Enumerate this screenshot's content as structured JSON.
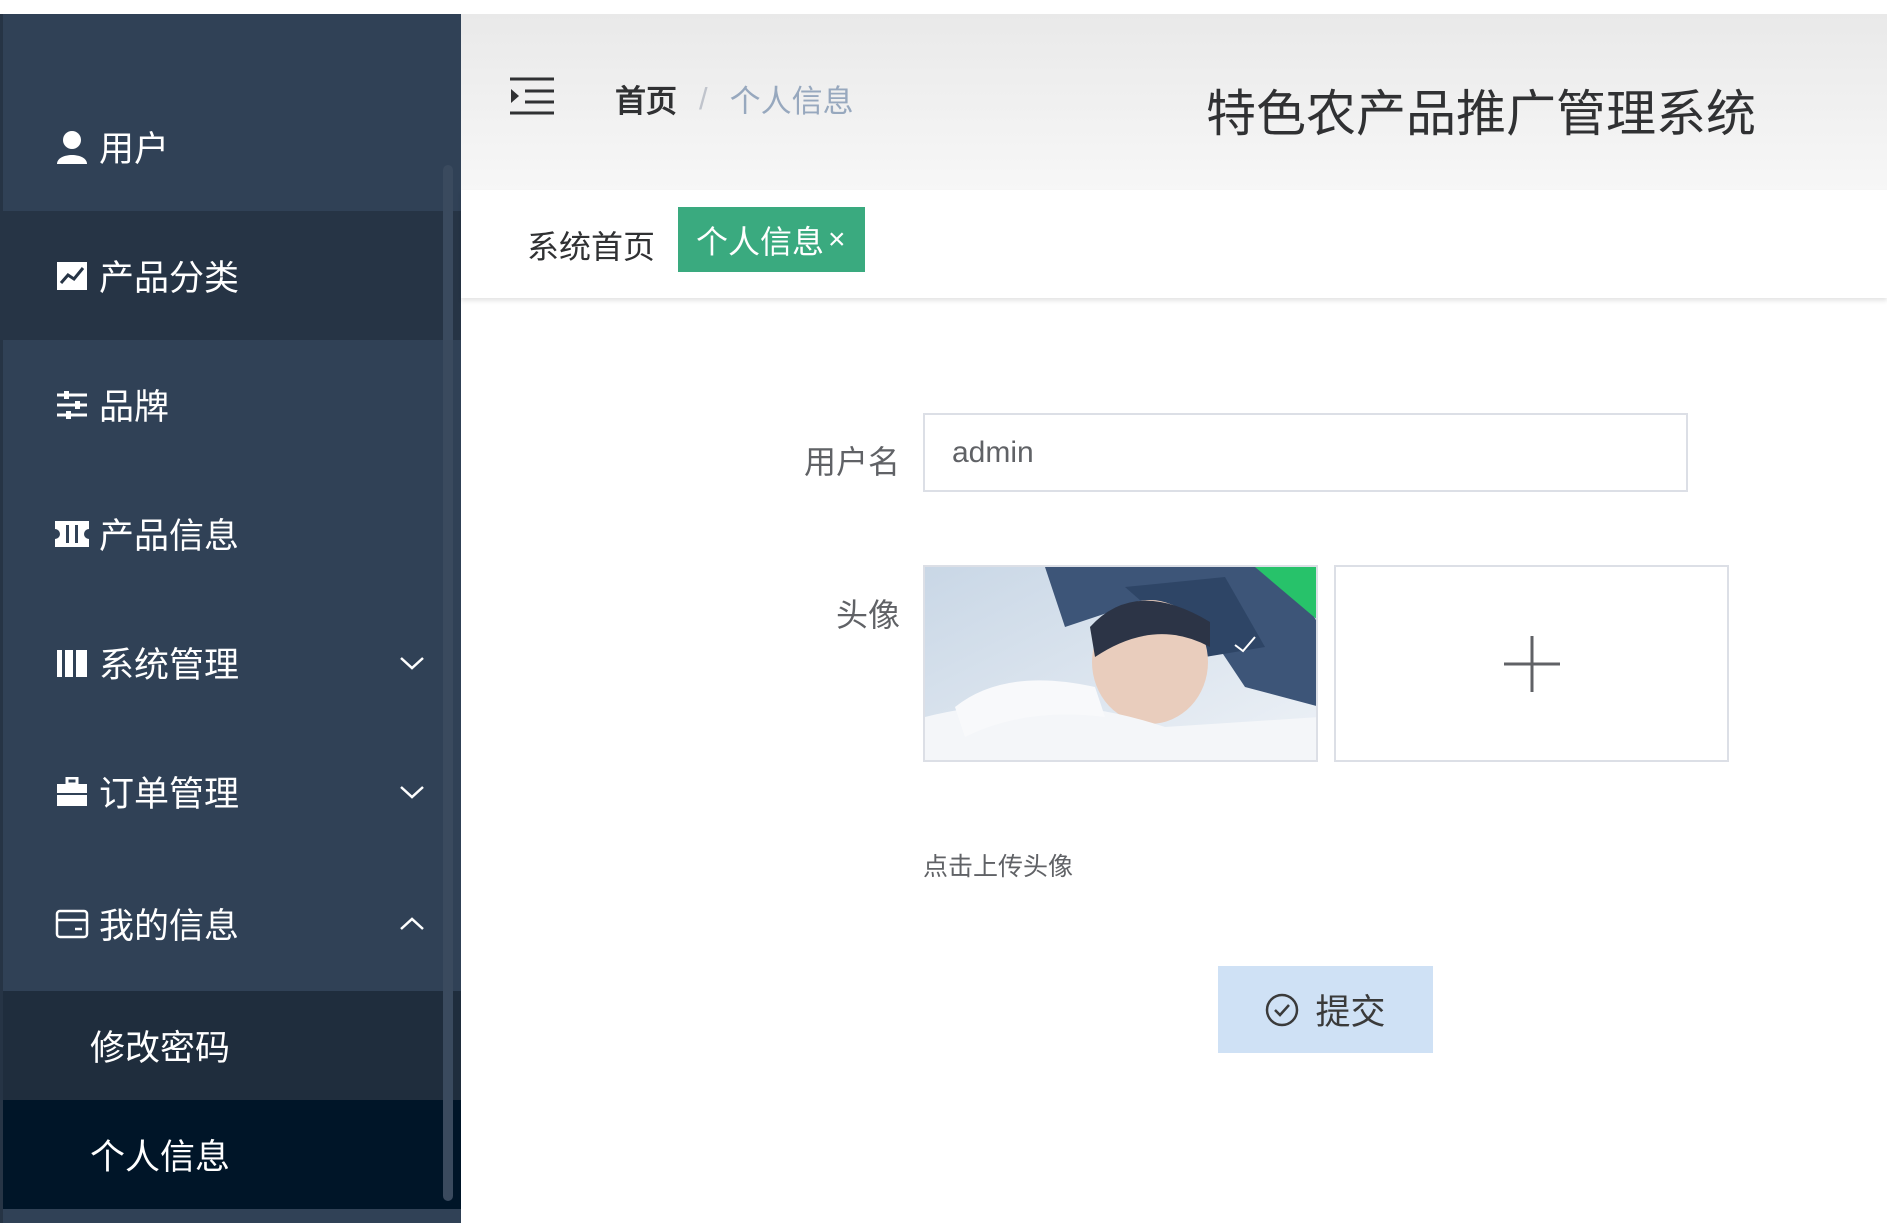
{
  "sidebar": {
    "items": [
      {
        "label": "用户",
        "icon": "user-icon"
      },
      {
        "label": "产品分类",
        "icon": "chart-icon"
      },
      {
        "label": "品牌",
        "icon": "sliders-icon"
      },
      {
        "label": "产品信息",
        "icon": "ticket-icon"
      },
      {
        "label": "系统管理",
        "icon": "books-icon"
      },
      {
        "label": "订单管理",
        "icon": "briefcase-icon"
      },
      {
        "label": "我的信息",
        "icon": "card-icon"
      }
    ],
    "subitems": [
      {
        "label": "修改密码"
      },
      {
        "label": "个人信息"
      }
    ]
  },
  "header": {
    "breadcrumb": {
      "home": "首页",
      "separator": "/",
      "current": "个人信息"
    },
    "title": "特色农产品推广管理系统"
  },
  "tags": {
    "home": "系统首页",
    "active": "个人信息",
    "close": "×"
  },
  "form": {
    "username_label": "用户名",
    "username_value": "admin",
    "avatar_label": "头像",
    "upload_hint": "点击上传头像",
    "submit_label": "提交"
  },
  "colors": {
    "sidebar_bg": "#304156",
    "sidebar_active": "#001528",
    "tag_active": "#3aaa7f",
    "submit_bg": "#cfe1f5"
  }
}
